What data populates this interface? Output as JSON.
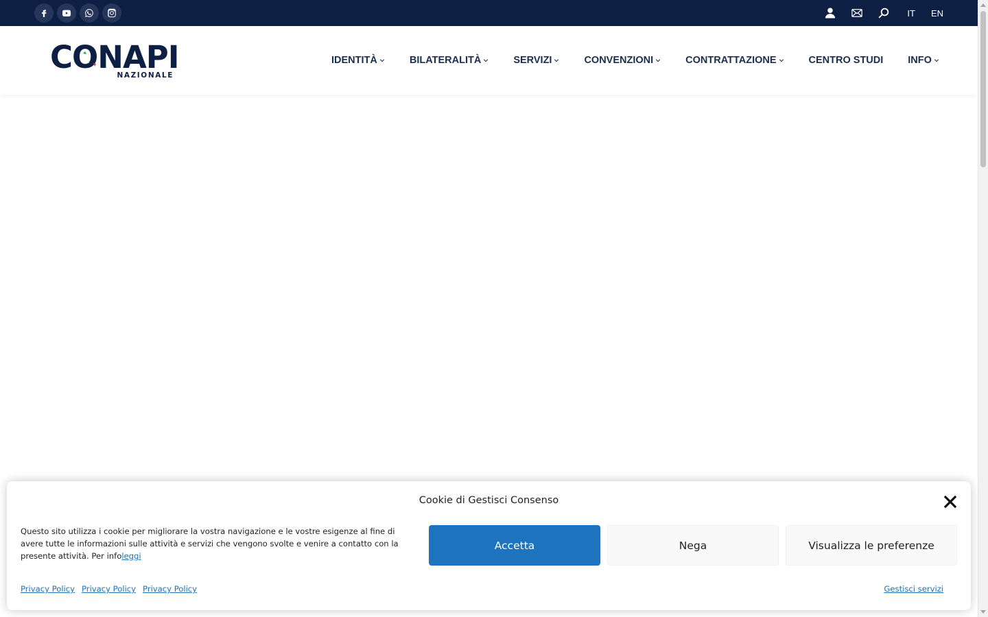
{
  "topbar": {
    "social": [
      "facebook-icon",
      "youtube-icon",
      "whatsapp-icon",
      "instagram-icon"
    ],
    "icons": [
      "user-icon",
      "mail-icon",
      "search-icon"
    ],
    "languages": [
      "IT",
      "EN"
    ]
  },
  "logo": {
    "name": "CONAPI",
    "subtitle": "NAZIONALE"
  },
  "nav": [
    {
      "label": "IDENTITÀ",
      "dropdown": true
    },
    {
      "label": "BILATERALITÀ",
      "dropdown": true
    },
    {
      "label": "SERVIZI",
      "dropdown": true
    },
    {
      "label": "CONVENZIONI",
      "dropdown": true
    },
    {
      "label": "CONTRATTAZIONE",
      "dropdown": true
    },
    {
      "label": "CENTRO STUDI",
      "dropdown": false
    },
    {
      "label": "INFO",
      "dropdown": true
    }
  ],
  "cookie": {
    "title": "Cookie di Gestisci Consenso",
    "message": "Questo sito utilizza i cookie per migliorare la vostra navigazione e le vostre esigenze al fine di avere tutte le informazioni sulle attività e servizi che vengono svolte e venire a contatto con la presente attività. Per info",
    "read_more": "leggi",
    "accept_label": "Accetta",
    "deny_label": "Nega",
    "prefs_label": "Visualizza le preferenze",
    "links": [
      "Privacy Policy",
      "Privacy Policy",
      "Privacy Policy"
    ],
    "manage_label": "Gestisci servizi"
  },
  "colors": {
    "topbar": "#0e1f44",
    "accent": "#1e73be",
    "nav_text": "#1d2d4f"
  }
}
